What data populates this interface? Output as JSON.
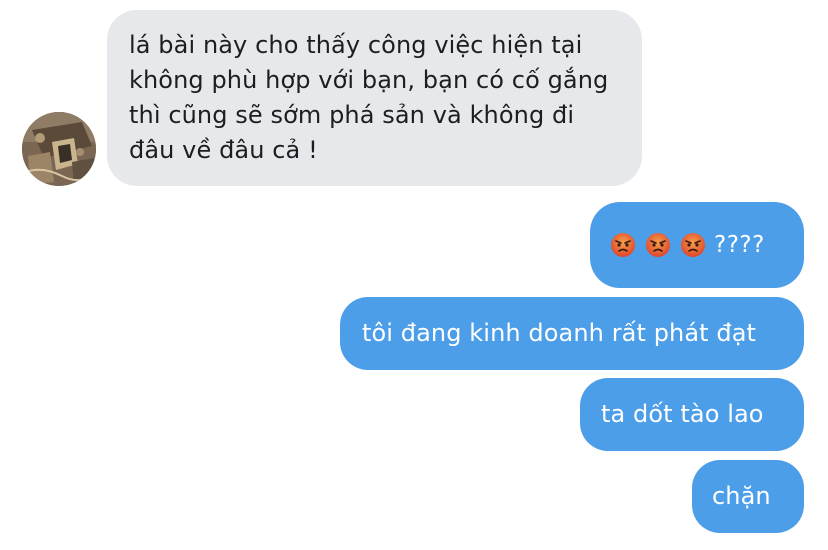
{
  "chat": {
    "incoming": {
      "avatar_icon": "tarot-reader-avatar",
      "text": "lá bài này cho thấy công việc hiện tại không phù hợp với bạn, bạn có cố gắng thì cũng sẽ sớm phá sản và không đi đâu về đâu cả !"
    },
    "outgoing": [
      {
        "emojis": [
          "angry-face-icon",
          "angry-face-icon",
          "angry-face-icon"
        ],
        "text": "????"
      },
      {
        "text": "tôi đang kinh doanh rất phát đạt"
      },
      {
        "text": "ta dốt tào lao"
      },
      {
        "text": "chặn"
      }
    ]
  },
  "colors": {
    "incoming_bubble": "#e6e8ec",
    "outgoing_bubble": "#4c9ee9",
    "outgoing_text": "#ffffff",
    "incoming_text": "#1c1e21"
  }
}
